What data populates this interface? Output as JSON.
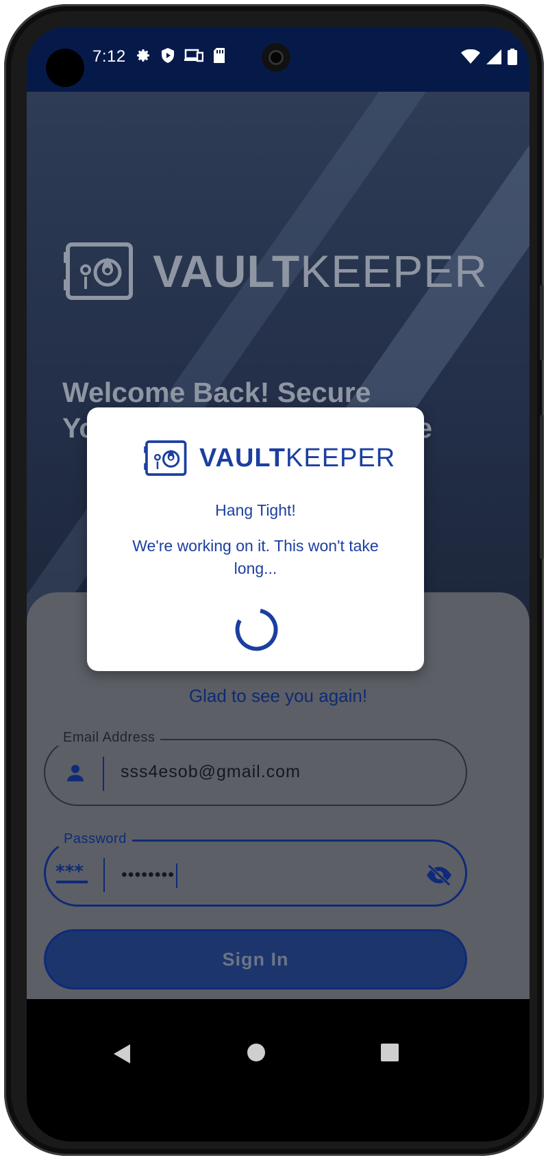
{
  "status_bar": {
    "time": "7:12",
    "icons": [
      "gear-icon",
      "shield-icon",
      "devices-icon",
      "sd-card-icon"
    ],
    "right_icons": [
      "wifi-icon",
      "signal-icon",
      "battery-icon"
    ]
  },
  "background": {
    "logo": {
      "bold": "VAULT",
      "light": "KEEPER"
    },
    "welcome_line1": "Welcome Back! Secure",
    "welcome_line2": "Yo",
    "welcome_line2_end": "e"
  },
  "modal": {
    "logo": {
      "bold": "VAULT",
      "light": "KEEPER"
    },
    "title": "Hang Tight!",
    "message": "We're working on it. This won't take long..."
  },
  "login": {
    "greeting": "Glad to see you again!",
    "email": {
      "label": "Email Address",
      "value": "sss4esob@gmail.com"
    },
    "password": {
      "label": "Password",
      "value": "••••••••"
    },
    "sign_in_label": "Sign In"
  },
  "colors": {
    "brand": "#1b3fa0",
    "status_bar": "#061a4a",
    "scrim": "rgba(0,0,0,0.55)"
  }
}
